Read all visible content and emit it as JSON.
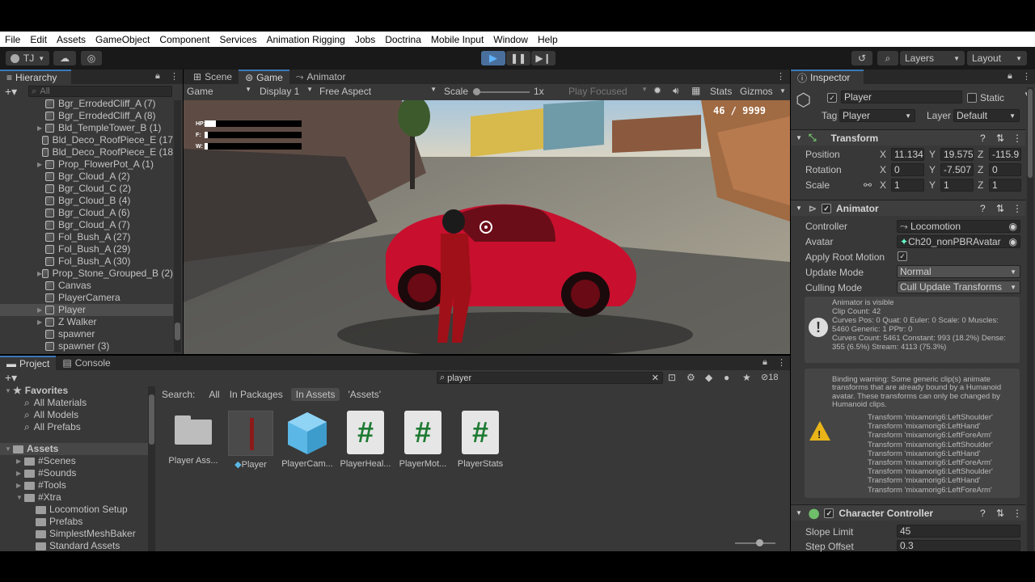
{
  "menubar": {
    "items": [
      "File",
      "Edit",
      "Assets",
      "GameObject",
      "Component",
      "Services",
      "Animation Rigging",
      "Jobs",
      "Doctrina",
      "Mobile Input",
      "Window",
      "Help"
    ]
  },
  "toolbar": {
    "account": "TJ",
    "layers": "Layers",
    "layout": "Layout"
  },
  "hierarchy": {
    "title": "Hierarchy",
    "search_placeholder": "All",
    "items": [
      {
        "label": "Bgr_ErrodedCliff_A (7)",
        "expand": false
      },
      {
        "label": "Bgr_ErrodedCliff_A (8)",
        "expand": false
      },
      {
        "label": "Bld_TempleTower_B (1)",
        "expand": true
      },
      {
        "label": "Bld_Deco_RoofPiece_E (17",
        "expand": false
      },
      {
        "label": "Bld_Deco_RoofPiece_E (18",
        "expand": false
      },
      {
        "label": "Prop_FlowerPot_A (1)",
        "expand": true
      },
      {
        "label": "Bgr_Cloud_A (2)",
        "expand": false
      },
      {
        "label": "Bgr_Cloud_C (2)",
        "expand": false
      },
      {
        "label": "Bgr_Cloud_B (4)",
        "expand": false
      },
      {
        "label": "Bgr_Cloud_A (6)",
        "expand": false
      },
      {
        "label": "Bgr_Cloud_A (7)",
        "expand": false
      },
      {
        "label": "Fol_Bush_A (27)",
        "expand": false
      },
      {
        "label": "Fol_Bush_A (29)",
        "expand": false
      },
      {
        "label": "Fol_Bush_A (30)",
        "expand": false
      },
      {
        "label": "Prop_Stone_Grouped_B (2)",
        "expand": true
      },
      {
        "label": "Canvas",
        "expand": false
      },
      {
        "label": "PlayerCamera",
        "expand": false
      },
      {
        "label": "Player",
        "expand": true,
        "selected": true
      },
      {
        "label": "Z Walker",
        "expand": true
      },
      {
        "label": "spawner",
        "expand": false
      },
      {
        "label": "spawner (3)",
        "expand": false
      }
    ]
  },
  "game": {
    "tabs": [
      "Scene",
      "Game",
      "Animator"
    ],
    "display_mode": "Game",
    "display": "Display 1",
    "aspect": "Free Aspect",
    "scale_label": "Scale",
    "scale_value": "1x",
    "play_focused": "Play Focused",
    "stats": "Stats",
    "gizmos": "Gizmos",
    "hud": {
      "hp": "HP:",
      "f": "F:",
      "w": "W:",
      "counter": "46 / 9999"
    }
  },
  "inspector": {
    "title": "Inspector",
    "object_name": "Player",
    "static_label": "Static",
    "tag_label": "Tag",
    "tag_value": "Player",
    "layer_label": "Layer",
    "layer_value": "Default",
    "transform": {
      "title": "Transform",
      "rows": [
        {
          "label": "Position",
          "x": "11.134:",
          "y": "19.575:",
          "z": "-115.9"
        },
        {
          "label": "Rotation",
          "x": "0",
          "y": "-7.507",
          "z": "0"
        },
        {
          "label": "Scale",
          "x": "1",
          "y": "1",
          "z": "1"
        }
      ]
    },
    "animator": {
      "title": "Animator",
      "controller_label": "Controller",
      "controller_value": "Locomotion",
      "avatar_label": "Avatar",
      "avatar_value": "Ch20_nonPBRAvatar",
      "root_motion_label": "Apply Root Motion",
      "update_mode_label": "Update Mode",
      "update_mode_value": "Normal",
      "culling_label": "Culling Mode",
      "culling_value": "Cull Update Transforms",
      "info_lines": [
        "Animator is visible",
        "Clip Count: 42",
        "Curves Pos: 0 Quat: 0 Euler: 0 Scale: 0 Muscles:",
        "5460 Generic: 1 PPtr: 0",
        "Curves Count: 5461 Constant: 993 (18.2%) Dense:",
        "355 (6.5%) Stream: 4113 (75.3%)"
      ],
      "warning_lines": [
        "Binding warning: Some generic clip(s) animate",
        "transforms that are already bound by a Humanoid",
        "avatar. These transforms can only be changed by",
        "Humanoid clips."
      ],
      "transform_lines": [
        "Transform 'mixamorig6:LeftShoulder'",
        "Transform 'mixamorig6:LeftHand'",
        "Transform 'mixamorig6:LeftForeArm'",
        "Transform 'mixamorig6:LeftShoulder'",
        "Transform 'mixamorig6:LeftHand'",
        "Transform 'mixamorig6:LeftForeArm'",
        "Transform 'mixamorig6:LeftShoulder'",
        "Transform 'mixamorig6:LeftHand'",
        "Transform 'mixamorig6:LeftForeArm'"
      ]
    },
    "character_controller": {
      "title": "Character Controller",
      "slope_label": "Slope Limit",
      "slope_value": "45",
      "step_label": "Step Offset",
      "step_value": "0.3"
    }
  },
  "project": {
    "tabs": [
      "Project",
      "Console"
    ],
    "search_value": "player",
    "hidden_count": "18",
    "search_label": "Search:",
    "filters": [
      "All",
      "In Packages",
      "In Assets",
      "'Assets'"
    ],
    "favorites": {
      "title": "Favorites",
      "items": [
        "All Materials",
        "All Models",
        "All Prefabs"
      ]
    },
    "assets_tree": [
      {
        "label": "Assets",
        "level": 0
      },
      {
        "label": "#Scenes",
        "level": 1
      },
      {
        "label": "#Sounds",
        "level": 1
      },
      {
        "label": "#Tools",
        "level": 1
      },
      {
        "label": "#Xtra",
        "level": 1
      },
      {
        "label": "Locomotion Setup",
        "level": 2
      },
      {
        "label": "Prefabs",
        "level": 2
      },
      {
        "label": "SimplestMeshBaker",
        "level": 2
      },
      {
        "label": "Standard Assets",
        "level": 2
      }
    ],
    "assets": [
      {
        "label": "Player Ass...",
        "kind": "folder"
      },
      {
        "label": "Player",
        "kind": "model"
      },
      {
        "label": "PlayerCam...",
        "kind": "prefab"
      },
      {
        "label": "PlayerHeal...",
        "kind": "script"
      },
      {
        "label": "PlayerMot...",
        "kind": "script"
      },
      {
        "label": "PlayerStats",
        "kind": "script"
      }
    ]
  },
  "colors": {
    "accent": "#3a79bb",
    "panel": "#383838",
    "dark": "#282828",
    "car": "#c8102e"
  }
}
